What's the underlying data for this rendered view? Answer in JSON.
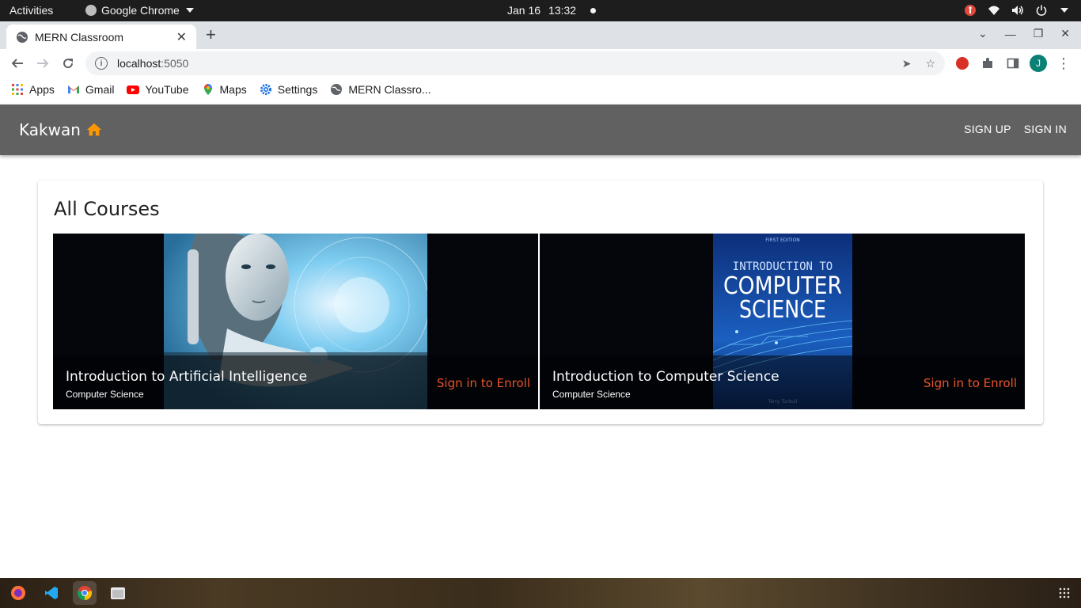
{
  "system": {
    "activities": "Activities",
    "app_name": "Google Chrome",
    "date": "Jan 16",
    "time": "13:32"
  },
  "browser": {
    "tab_title": "MERN Classroom",
    "url_host": "localhost",
    "url_port": ":5050",
    "bookmarks": [
      {
        "label": "Apps",
        "icon": "apps-grid-icon"
      },
      {
        "label": "Gmail",
        "icon": "gmail-icon"
      },
      {
        "label": "YouTube",
        "icon": "youtube-icon"
      },
      {
        "label": "Maps",
        "icon": "maps-icon"
      },
      {
        "label": "Settings",
        "icon": "settings-gear-icon"
      },
      {
        "label": "MERN Classro...",
        "icon": "globe-icon"
      }
    ],
    "profile_initial": "J"
  },
  "app": {
    "brand": "Kakwan",
    "nav": {
      "signup": "SIGN UP",
      "signin": "SIGN IN"
    },
    "section_title": "All Courses",
    "courses": [
      {
        "title": "Introduction to Artificial Intelligence",
        "category": "Computer Science",
        "action": "Sign in to Enroll"
      },
      {
        "title": "Introduction to Computer Science",
        "category": "Computer Science",
        "action": "Sign in to Enroll"
      }
    ],
    "book_cover": {
      "edition": "FIRST EDITION",
      "line1": "INTRODUCTION TO",
      "line2": "COMPUTER",
      "line3": "SCIENCE",
      "author": "Terry Turbull"
    },
    "colors": {
      "appbar": "#616161",
      "accent": "#ff9800",
      "enroll": "#e8542a"
    }
  }
}
